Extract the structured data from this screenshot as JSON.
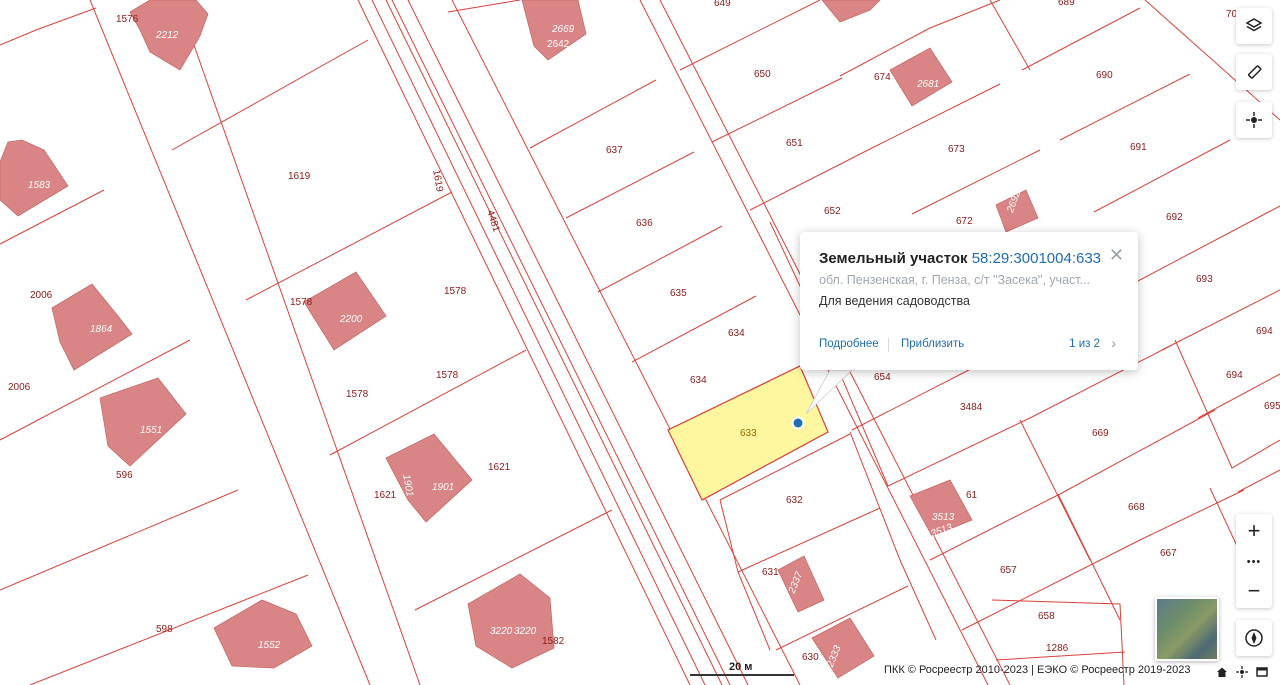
{
  "popup": {
    "title": "Земельный участок",
    "cadastral_number": "58:29:3001004:633",
    "address": "обл. Пензенская, г. Пенза, с/т \"Засека\", участ...",
    "usage": "Для ведения садоводства",
    "details_link": "Подробнее",
    "zoom_link": "Приблизить",
    "counter": "1 из 2",
    "close_icon": "close-icon",
    "next_icon": "chevron-right-icon"
  },
  "controls": {
    "layers_icon": "layers-icon",
    "ruler_icon": "ruler-icon",
    "locate_icon": "crosshair-icon",
    "zoom_in": "+",
    "more": "•••",
    "zoom_out": "−",
    "compass_icon": "compass-icon",
    "basemap_icon": "satellite-thumbnail"
  },
  "scale": {
    "label": "20 м"
  },
  "attribution": "ПКК © Росреестр 2010-2023 | ЕЭКО © Росреестр 2019-2023",
  "colors": {
    "parcel_line": "#d9413a",
    "building": "#d98585",
    "selected_fill": "#fff7a0",
    "link": "#1f6cb3"
  },
  "map_labels": {
    "p1576": "1576",
    "b2212": "2212",
    "b2669": "2669",
    "b2642": "2642",
    "p649": "649",
    "p689": "689",
    "p70": "70",
    "p650": "650",
    "p674": "674",
    "b2681": "2681",
    "p690": "690",
    "p637": "637",
    "p651": "651",
    "p673": "673",
    "p691": "691",
    "b1583": "1583",
    "p1619a": "1619",
    "p1619b": "1619",
    "p4481": "4481",
    "p636": "636",
    "p652": "652",
    "p672": "672",
    "b2692": "2692",
    "p692": "692",
    "p2006a": "2006",
    "b1864": "1864",
    "p1578a": "1578",
    "b2200": "2200",
    "p1578b": "1578",
    "p635": "635",
    "p693": "693",
    "p634a": "634",
    "p694a": "694",
    "p634b": "634",
    "p654": "654",
    "p694b": "694",
    "p2006b": "2006",
    "p1578c": "1578",
    "p1578d": "1578",
    "p3484": "3484",
    "p695": "695",
    "b1551": "1551",
    "p633": "633",
    "p669": "669",
    "p596": "596",
    "p1621a": "1621",
    "b1901a": "1901",
    "b1901b": "1901",
    "p1621b": "1621",
    "p632": "632",
    "p61": "61",
    "b3513a": "3513",
    "b3513b": "3513",
    "p668": "668",
    "p667": "667",
    "p631": "631",
    "b2337": "2337",
    "p657": "657",
    "p598": "598",
    "b1552": "1552",
    "b3220a": "3220",
    "b3220b": "3220",
    "p1582": "1582",
    "p658": "658",
    "p1286": "1286",
    "p630": "630",
    "b2333": "2333"
  }
}
